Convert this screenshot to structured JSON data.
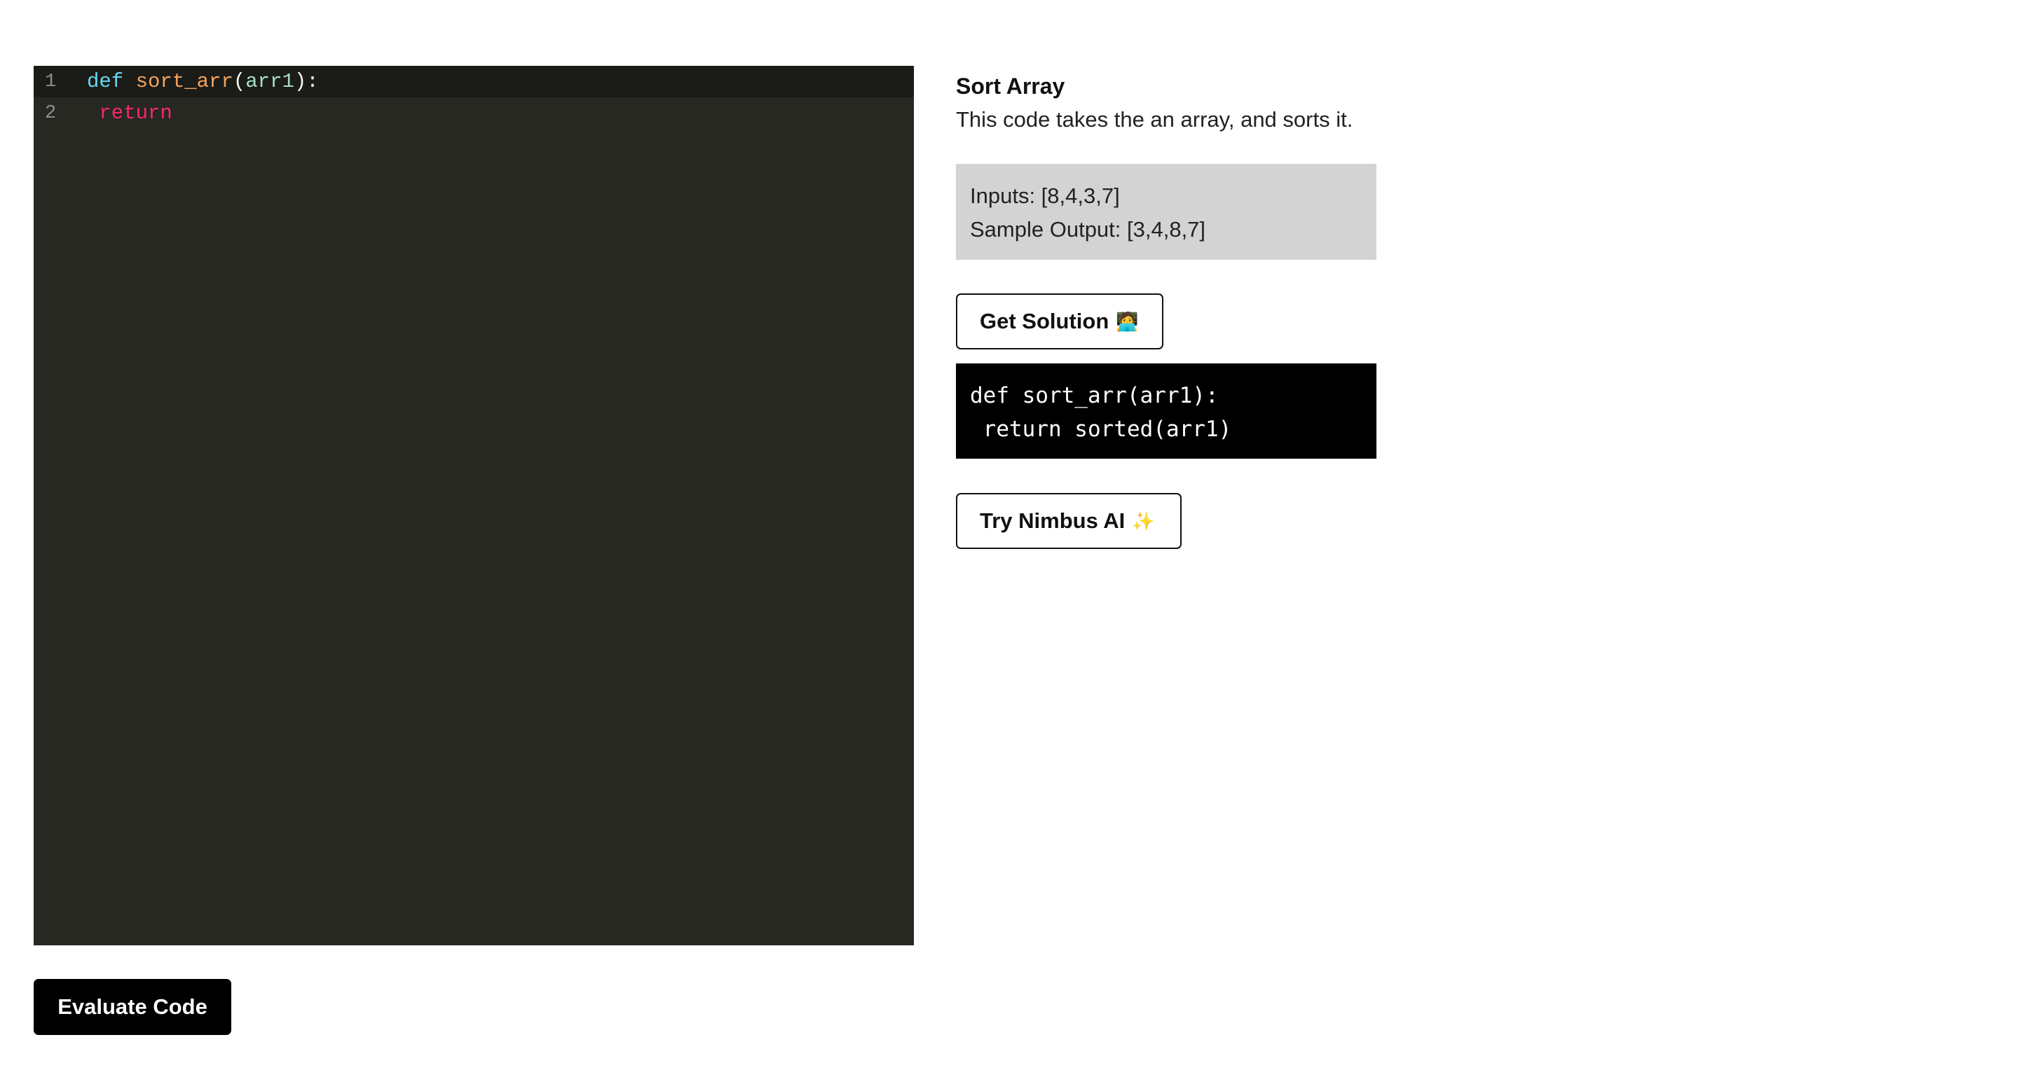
{
  "editor": {
    "lines": [
      {
        "number": "1",
        "tokens": {
          "kw": "def",
          "space1": " ",
          "fn": "sort_arr",
          "open": "(",
          "param": "arr1",
          "close": "):"
        }
      },
      {
        "number": "2",
        "tokens": {
          "indent": " ",
          "kw": "return"
        }
      }
    ],
    "colors": {
      "background": "#272822",
      "active_line": "#1b1b18",
      "keyword_def": "#66d9ef",
      "function_name": "#f5a55a",
      "parameter": "#a6e1c5",
      "keyword_return": "#f92672"
    }
  },
  "evaluate_button": {
    "label": "Evaluate Code"
  },
  "problem": {
    "title": "Sort Array",
    "description": "This code takes the an array, and sorts it.",
    "inputs_line": "Inputs: [8,4,3,7]",
    "sample_output_line": "Sample Output: [3,4,8,7]"
  },
  "get_solution_button": {
    "label": "Get Solution",
    "emoji": "🧑‍💻"
  },
  "solution": {
    "line1": "def sort_arr(arr1):",
    "line2": " return sorted(arr1)"
  },
  "try_ai_button": {
    "label": "Try Nimbus AI",
    "emoji": "✨"
  }
}
